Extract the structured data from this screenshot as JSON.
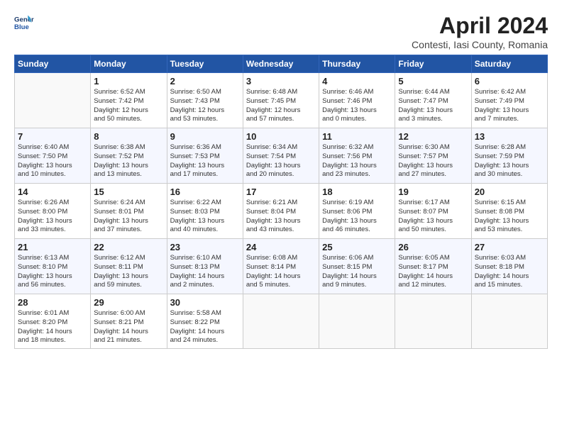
{
  "header": {
    "logo_line1": "General",
    "logo_line2": "Blue",
    "title": "April 2024",
    "subtitle": "Contesti, Iasi County, Romania"
  },
  "weekdays": [
    "Sunday",
    "Monday",
    "Tuesday",
    "Wednesday",
    "Thursday",
    "Friday",
    "Saturday"
  ],
  "weeks": [
    [
      {
        "day": "",
        "text": ""
      },
      {
        "day": "1",
        "text": "Sunrise: 6:52 AM\nSunset: 7:42 PM\nDaylight: 12 hours\nand 50 minutes."
      },
      {
        "day": "2",
        "text": "Sunrise: 6:50 AM\nSunset: 7:43 PM\nDaylight: 12 hours\nand 53 minutes."
      },
      {
        "day": "3",
        "text": "Sunrise: 6:48 AM\nSunset: 7:45 PM\nDaylight: 12 hours\nand 57 minutes."
      },
      {
        "day": "4",
        "text": "Sunrise: 6:46 AM\nSunset: 7:46 PM\nDaylight: 13 hours\nand 0 minutes."
      },
      {
        "day": "5",
        "text": "Sunrise: 6:44 AM\nSunset: 7:47 PM\nDaylight: 13 hours\nand 3 minutes."
      },
      {
        "day": "6",
        "text": "Sunrise: 6:42 AM\nSunset: 7:49 PM\nDaylight: 13 hours\nand 7 minutes."
      }
    ],
    [
      {
        "day": "7",
        "text": "Sunrise: 6:40 AM\nSunset: 7:50 PM\nDaylight: 13 hours\nand 10 minutes."
      },
      {
        "day": "8",
        "text": "Sunrise: 6:38 AM\nSunset: 7:52 PM\nDaylight: 13 hours\nand 13 minutes."
      },
      {
        "day": "9",
        "text": "Sunrise: 6:36 AM\nSunset: 7:53 PM\nDaylight: 13 hours\nand 17 minutes."
      },
      {
        "day": "10",
        "text": "Sunrise: 6:34 AM\nSunset: 7:54 PM\nDaylight: 13 hours\nand 20 minutes."
      },
      {
        "day": "11",
        "text": "Sunrise: 6:32 AM\nSunset: 7:56 PM\nDaylight: 13 hours\nand 23 minutes."
      },
      {
        "day": "12",
        "text": "Sunrise: 6:30 AM\nSunset: 7:57 PM\nDaylight: 13 hours\nand 27 minutes."
      },
      {
        "day": "13",
        "text": "Sunrise: 6:28 AM\nSunset: 7:59 PM\nDaylight: 13 hours\nand 30 minutes."
      }
    ],
    [
      {
        "day": "14",
        "text": "Sunrise: 6:26 AM\nSunset: 8:00 PM\nDaylight: 13 hours\nand 33 minutes."
      },
      {
        "day": "15",
        "text": "Sunrise: 6:24 AM\nSunset: 8:01 PM\nDaylight: 13 hours\nand 37 minutes."
      },
      {
        "day": "16",
        "text": "Sunrise: 6:22 AM\nSunset: 8:03 PM\nDaylight: 13 hours\nand 40 minutes."
      },
      {
        "day": "17",
        "text": "Sunrise: 6:21 AM\nSunset: 8:04 PM\nDaylight: 13 hours\nand 43 minutes."
      },
      {
        "day": "18",
        "text": "Sunrise: 6:19 AM\nSunset: 8:06 PM\nDaylight: 13 hours\nand 46 minutes."
      },
      {
        "day": "19",
        "text": "Sunrise: 6:17 AM\nSunset: 8:07 PM\nDaylight: 13 hours\nand 50 minutes."
      },
      {
        "day": "20",
        "text": "Sunrise: 6:15 AM\nSunset: 8:08 PM\nDaylight: 13 hours\nand 53 minutes."
      }
    ],
    [
      {
        "day": "21",
        "text": "Sunrise: 6:13 AM\nSunset: 8:10 PM\nDaylight: 13 hours\nand 56 minutes."
      },
      {
        "day": "22",
        "text": "Sunrise: 6:12 AM\nSunset: 8:11 PM\nDaylight: 13 hours\nand 59 minutes."
      },
      {
        "day": "23",
        "text": "Sunrise: 6:10 AM\nSunset: 8:13 PM\nDaylight: 14 hours\nand 2 minutes."
      },
      {
        "day": "24",
        "text": "Sunrise: 6:08 AM\nSunset: 8:14 PM\nDaylight: 14 hours\nand 5 minutes."
      },
      {
        "day": "25",
        "text": "Sunrise: 6:06 AM\nSunset: 8:15 PM\nDaylight: 14 hours\nand 9 minutes."
      },
      {
        "day": "26",
        "text": "Sunrise: 6:05 AM\nSunset: 8:17 PM\nDaylight: 14 hours\nand 12 minutes."
      },
      {
        "day": "27",
        "text": "Sunrise: 6:03 AM\nSunset: 8:18 PM\nDaylight: 14 hours\nand 15 minutes."
      }
    ],
    [
      {
        "day": "28",
        "text": "Sunrise: 6:01 AM\nSunset: 8:20 PM\nDaylight: 14 hours\nand 18 minutes."
      },
      {
        "day": "29",
        "text": "Sunrise: 6:00 AM\nSunset: 8:21 PM\nDaylight: 14 hours\nand 21 minutes."
      },
      {
        "day": "30",
        "text": "Sunrise: 5:58 AM\nSunset: 8:22 PM\nDaylight: 14 hours\nand 24 minutes."
      },
      {
        "day": "",
        "text": ""
      },
      {
        "day": "",
        "text": ""
      },
      {
        "day": "",
        "text": ""
      },
      {
        "day": "",
        "text": ""
      }
    ]
  ]
}
